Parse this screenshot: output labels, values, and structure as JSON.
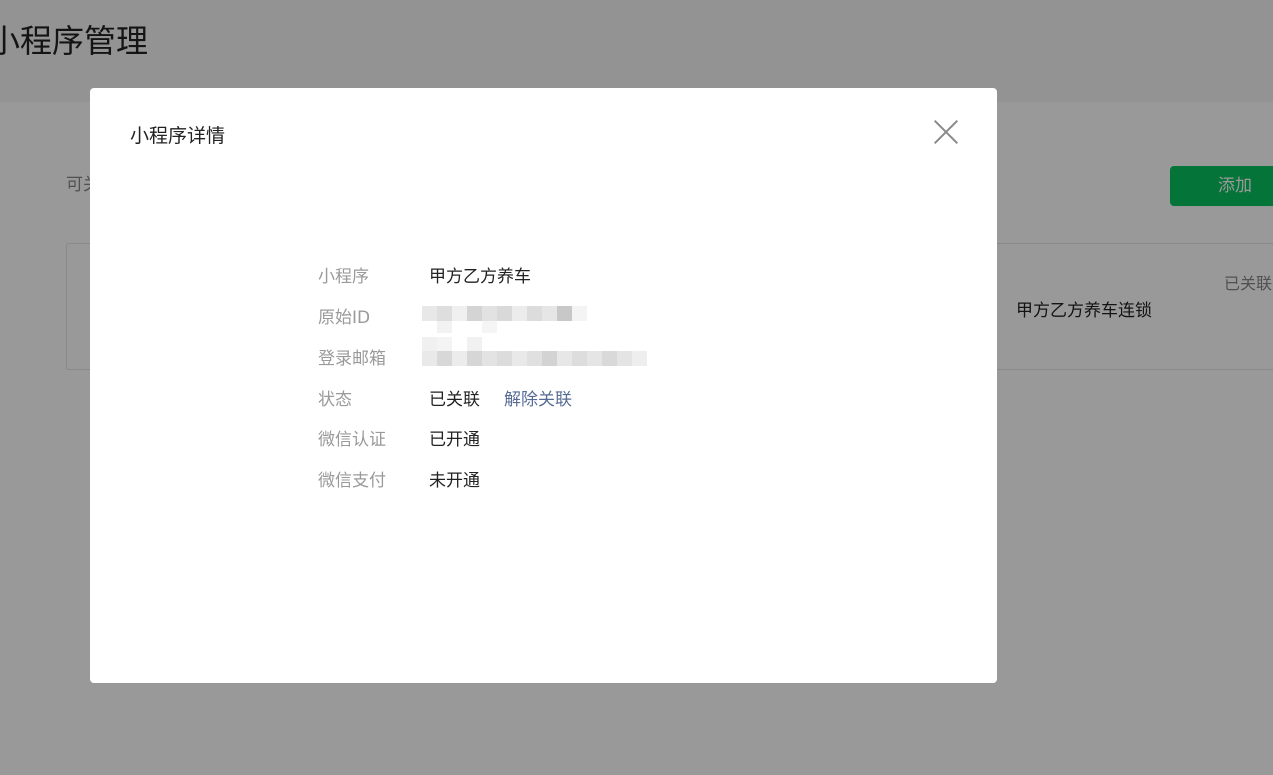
{
  "page": {
    "title": "小程序管理",
    "hint_text": "可关",
    "add_label": "添加",
    "card_name": "甲方乙方养车连锁",
    "card_status": "已关联"
  },
  "dialog": {
    "title": "小程序详情",
    "rows": {
      "app_label": "小程序",
      "app_value": "甲方乙方养车",
      "id_label": "原始ID",
      "email_label": "登录邮箱",
      "status_label": "状态",
      "status_value": "已关联",
      "unlink_label": "解除关联",
      "wechat_verify_label": "微信认证",
      "wechat_verify_value": "已开通",
      "wechat_pay_label": "微信支付",
      "wechat_pay_value": "未开通"
    }
  },
  "colors": {
    "accent_green": "#07c160",
    "link_blue": "#576b95",
    "mask": "rgba(0,0,0,0.40)"
  },
  "icons": {
    "close": "close-icon"
  }
}
